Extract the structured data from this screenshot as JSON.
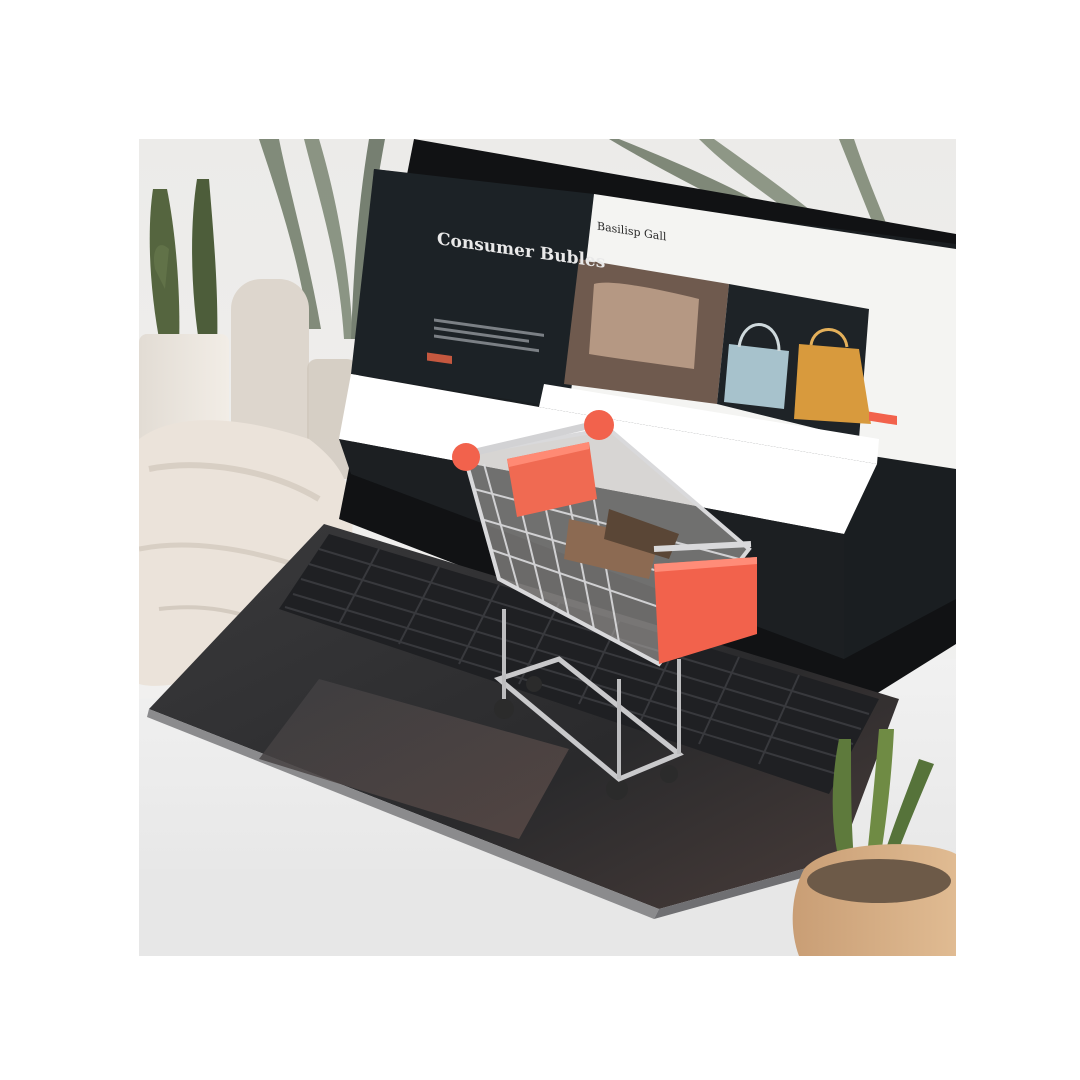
{
  "scene": {
    "subject": "miniature-shopping-cart-on-laptop",
    "accent_color": "#f2624c",
    "screen_site": {
      "hero_heading": "Consumer Bubles",
      "brand_text": "Basilisp Gall"
    }
  }
}
